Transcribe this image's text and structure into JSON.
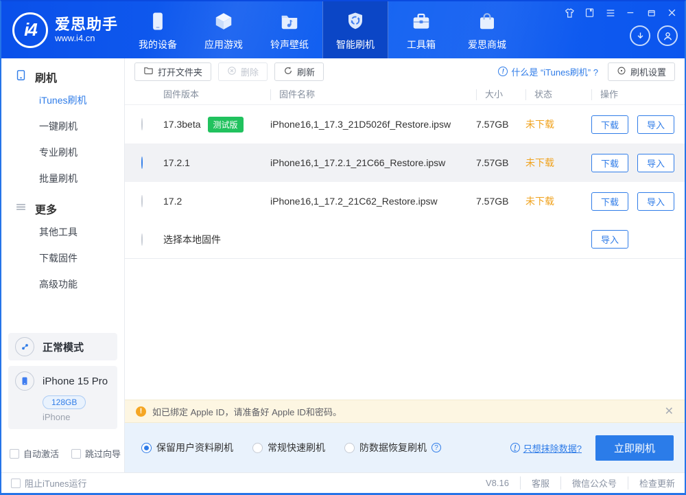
{
  "colors": {
    "accent_blue": "#2f7ce8",
    "header_blue": "#0b55ee",
    "active_tab_blue": "#0b46c6",
    "status_orange": "#f0a21d",
    "badge_green": "#21c25e",
    "notice_bg": "#fdf6e2",
    "options_bg": "#e9f2fc"
  },
  "header": {
    "logo_badge": "i4",
    "logo_title": "爱思助手",
    "logo_url": "www.i4.cn",
    "nav": [
      {
        "label": "我的设备"
      },
      {
        "label": "应用游戏"
      },
      {
        "label": "铃声壁纸"
      },
      {
        "label": "智能刷机",
        "active": true
      },
      {
        "label": "工具箱"
      },
      {
        "label": "爱思商城"
      }
    ]
  },
  "sidebar": {
    "sections": [
      {
        "title": "刷机",
        "items": [
          {
            "label": "iTunes刷机",
            "active": true
          },
          {
            "label": "一键刷机"
          },
          {
            "label": "专业刷机"
          },
          {
            "label": "批量刷机"
          }
        ]
      },
      {
        "title": "更多",
        "items": [
          {
            "label": "其他工具"
          },
          {
            "label": "下载固件"
          },
          {
            "label": "高级功能"
          }
        ]
      }
    ],
    "mode_card": {
      "label": "正常模式"
    },
    "device_card": {
      "name": "iPhone 15 Pro",
      "capacity": "128GB",
      "type": "iPhone"
    },
    "checkboxes": [
      {
        "label": "自动激活",
        "checked": false
      },
      {
        "label": "跳过向导",
        "checked": false
      }
    ]
  },
  "toolbar": {
    "open_folder_label": "打开文件夹",
    "delete_label": "删除",
    "refresh_label": "刷新",
    "help_link": "什么是 “iTunes刷机” ?",
    "settings_label": "刷机设置"
  },
  "table": {
    "headers": {
      "version": "固件版本",
      "name": "固件名称",
      "size": "大小",
      "status": "状态",
      "actions": "操作"
    },
    "download_label": "下载",
    "import_label": "导入",
    "rows": [
      {
        "version": "17.3beta",
        "badge": "测试版",
        "name": "iPhone16,1_17.3_21D5026f_Restore.ipsw",
        "size": "7.57GB",
        "status": "未下载",
        "selected": false
      },
      {
        "version": "17.2.1",
        "name": "iPhone16,1_17.2.1_21C66_Restore.ipsw",
        "size": "7.57GB",
        "status": "未下载",
        "selected": true
      },
      {
        "version": "17.2",
        "name": "iPhone16,1_17.2_21C62_Restore.ipsw",
        "size": "7.57GB",
        "status": "未下载",
        "selected": false
      },
      {
        "version": "选择本地固件",
        "local": true,
        "selected": false
      }
    ]
  },
  "notice": {
    "text": "如已绑定 Apple ID，请准备好 Apple ID和密码。"
  },
  "flash_options": {
    "radios": [
      {
        "label": "保留用户资料刷机",
        "checked": true
      },
      {
        "label": "常规快速刷机",
        "checked": false
      },
      {
        "label": "防数据恢复刷机",
        "checked": false,
        "has_help": true
      }
    ],
    "erase_link": "只想抹除数据?",
    "flash_button": "立即刷机"
  },
  "statusbar": {
    "block_itunes_label": "阻止iTunes运行",
    "version": "V8.16",
    "links": [
      "客服",
      "微信公众号",
      "检查更新"
    ]
  }
}
